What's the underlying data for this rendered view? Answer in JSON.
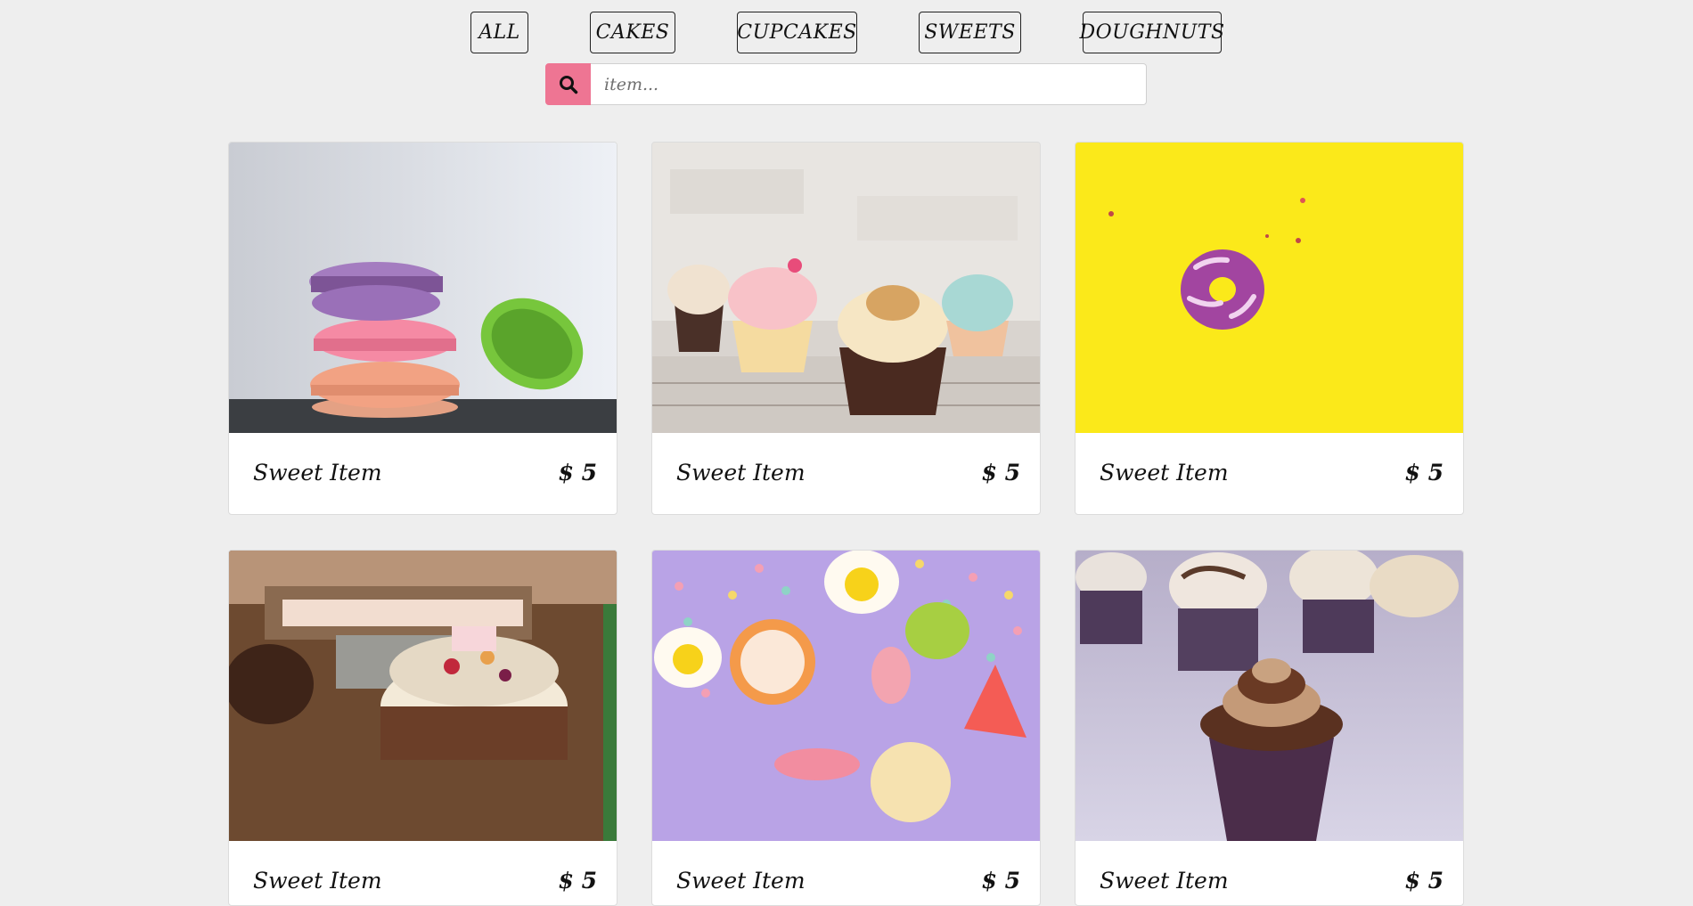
{
  "filters": [
    {
      "label": "ALL"
    },
    {
      "label": "CAKES"
    },
    {
      "label": "CUPCAKES"
    },
    {
      "label": "SWEETS"
    },
    {
      "label": "DOUGHNUTS"
    }
  ],
  "search": {
    "placeholder": "item...",
    "icon": "search-icon",
    "button_color": "#ee7593"
  },
  "items": [
    {
      "title": "Sweet Item",
      "price": "$ 5",
      "image": "macarons"
    },
    {
      "title": "Sweet Item",
      "price": "$ 5",
      "image": "cupcakes"
    },
    {
      "title": "Sweet Item",
      "price": "$ 5",
      "image": "doughnut"
    },
    {
      "title": "Sweet Item",
      "price": "$ 5",
      "image": "cake"
    },
    {
      "title": "Sweet Item",
      "price": "$ 5",
      "image": "candies"
    },
    {
      "title": "Sweet Item",
      "price": "$ 5",
      "image": "chocolate-cupcakes"
    }
  ]
}
